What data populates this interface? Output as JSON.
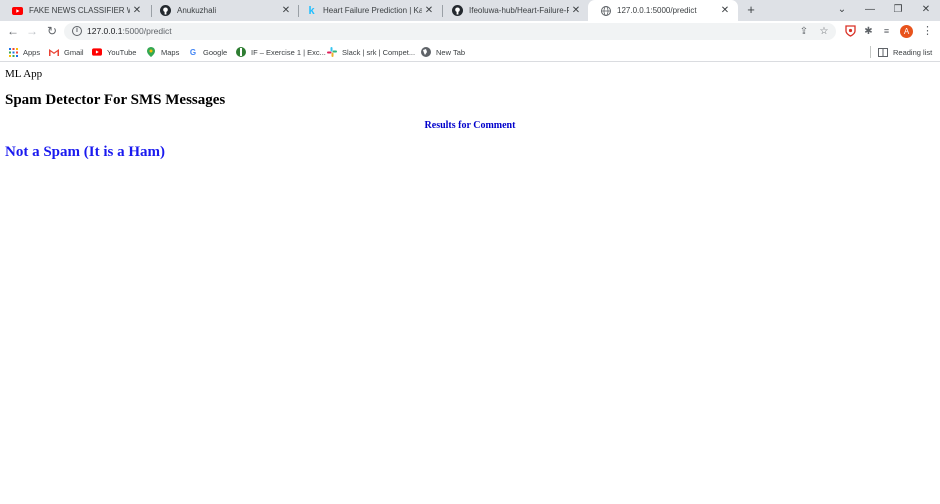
{
  "tabs": [
    {
      "title": "FAKE NEWS CLASSIFIER WITH M",
      "icon": "youtube-icon"
    },
    {
      "title": "Anukuzhali",
      "icon": "github-icon"
    },
    {
      "title": "Heart Failure Prediction | Kaggle",
      "icon": "kaggle-icon"
    },
    {
      "title": "Ifeoluwa-hub/Heart-Failure-Predi",
      "icon": "github-icon"
    },
    {
      "title": "127.0.0.1:5000/predict",
      "icon": "globe-icon",
      "active": true
    }
  ],
  "address_bar": {
    "host": "127.0.0.1",
    "path": ":5000/predict"
  },
  "bookmarks": [
    {
      "label": "Apps",
      "icon": "apps-grid-icon"
    },
    {
      "label": "Gmail",
      "icon": "gmail-icon"
    },
    {
      "label": "YouTube",
      "icon": "youtube-icon"
    },
    {
      "label": "Maps",
      "icon": "maps-pin-icon"
    },
    {
      "label": "Google",
      "icon": "google-icon"
    },
    {
      "label": "IF – Exercise 1 | Exc...",
      "icon": "globe-icon"
    },
    {
      "label": "Slack | srk | Compet...",
      "icon": "slack-icon"
    },
    {
      "label": "New Tab",
      "icon": "globe-icon"
    }
  ],
  "reading_list": "Reading list",
  "profile_initial": "A",
  "page": {
    "brand": "ML App",
    "heading": "Spam Detector For SMS Messages",
    "results_label": "Results for Comment",
    "prediction": "Not a Spam (It is a Ham)"
  },
  "colors": {
    "results_label": "#0000cc",
    "prediction": "#1a1aef",
    "avatar": "#e8531c"
  }
}
